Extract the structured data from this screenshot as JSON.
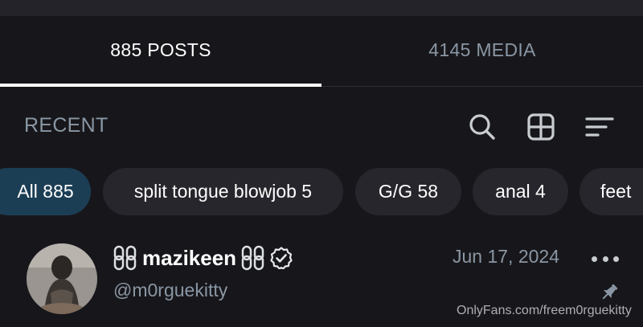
{
  "tabs": [
    {
      "label": "885 POSTS",
      "active": true
    },
    {
      "label": "4145 MEDIA",
      "active": false
    }
  ],
  "section": {
    "title": "RECENT"
  },
  "toolbar": {
    "icons": [
      "search-icon",
      "grid-icon",
      "sort-icon"
    ]
  },
  "chips": [
    {
      "label": "All 885",
      "selected": true
    },
    {
      "label": "split tongue blowjob 5",
      "selected": false
    },
    {
      "label": "G/G 58",
      "selected": false
    },
    {
      "label": "anal 4",
      "selected": false
    },
    {
      "label": "feet",
      "selected": false
    }
  ],
  "post": {
    "name": "mazikeen",
    "handle": "@m0rguekitty",
    "date": "Jun 17, 2024",
    "verified": true,
    "pinned": true
  },
  "watermark": "OnlyFans.com/freem0rguekitty",
  "colors": {
    "background": "#17171b",
    "muted_text": "#8a96a3",
    "chip_bg": "#26262c",
    "chip_selected_bg": "#1c3e55"
  }
}
